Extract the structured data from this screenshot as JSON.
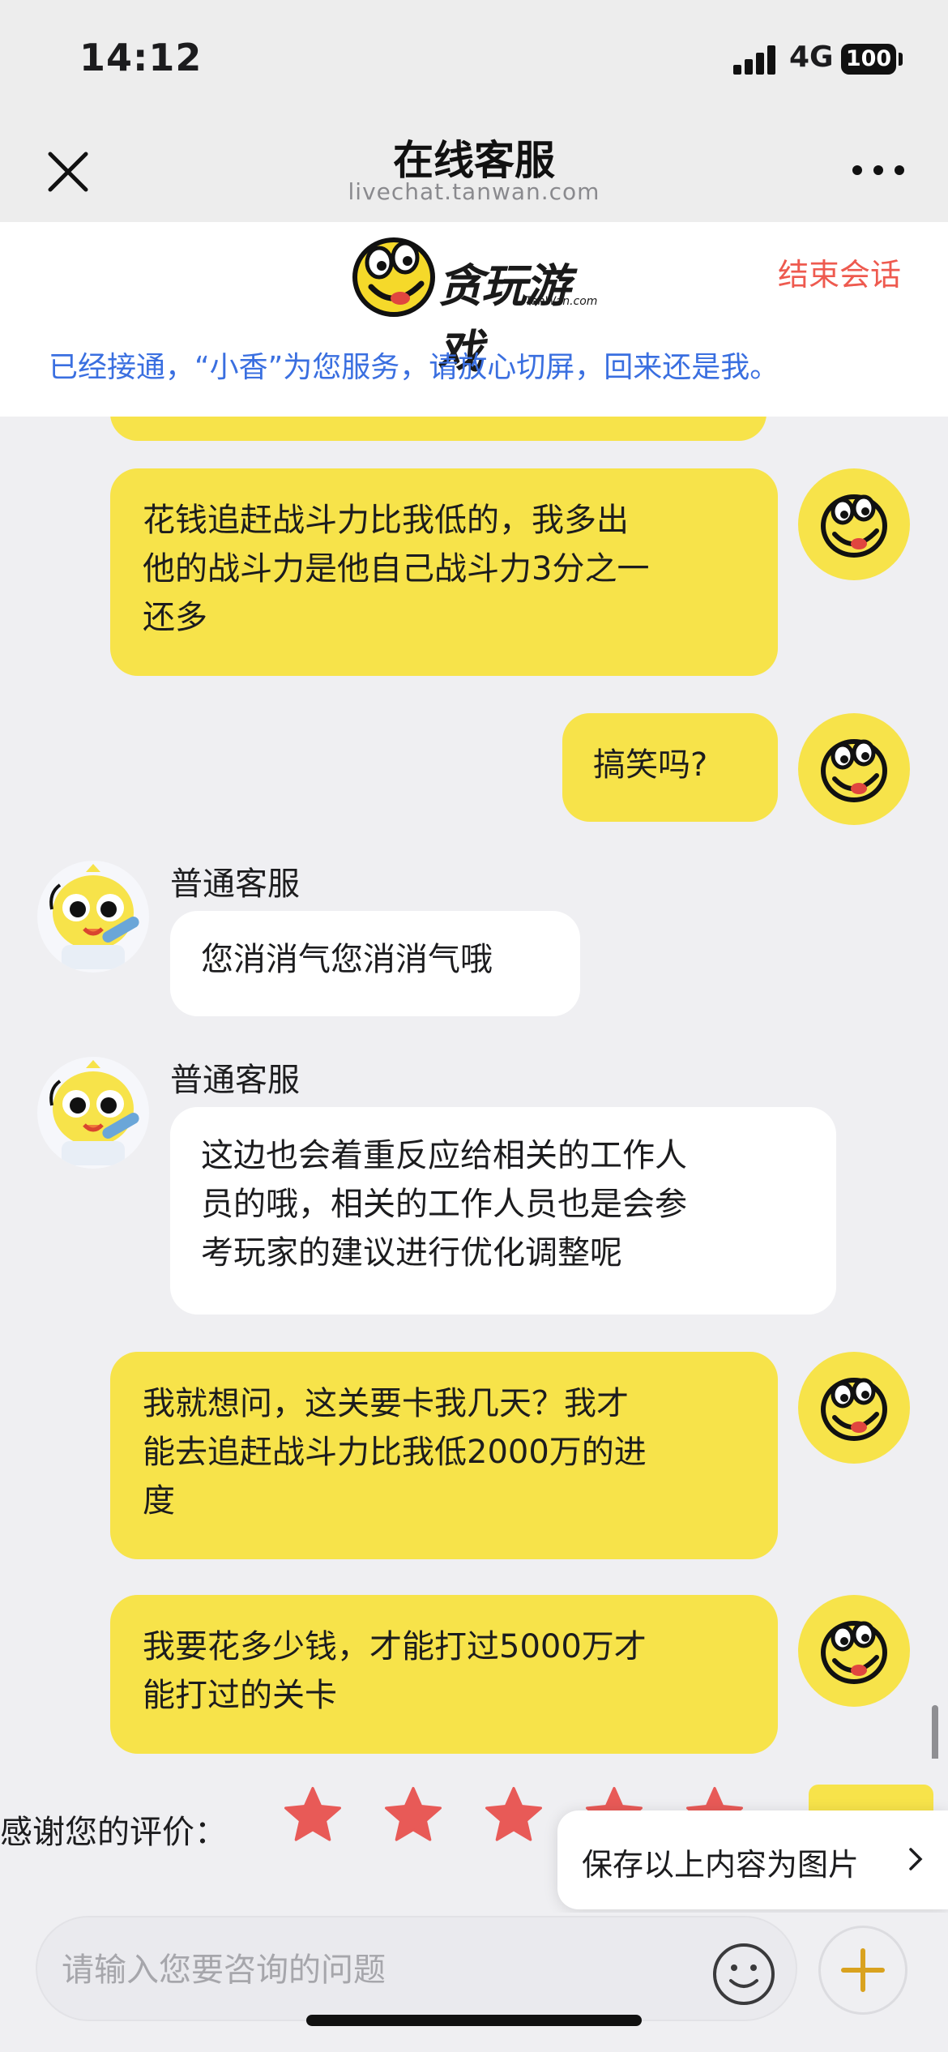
{
  "status_bar": {
    "time": "14:12",
    "network": "4G",
    "battery": "100"
  },
  "nav": {
    "title": "在线客服",
    "subtitle": "livechat.tanwan.com",
    "close_icon": "close-icon",
    "more_icon": "more-icon"
  },
  "header": {
    "logo_text": "贪玩游戏",
    "logo_sub": "TanWan.com",
    "end_chat": "结束会话",
    "notice": "已经接通，“小香”为您服务，请放心切屏，回来还是我。"
  },
  "messages": [
    {
      "from": "user",
      "lines": [
        "花钱追赶战斗力比我低的，我多出",
        "他的战斗力是他自己战斗力3分之一",
        "还多"
      ]
    },
    {
      "from": "user",
      "lines": [
        "搞笑吗?"
      ]
    },
    {
      "from": "agent",
      "name": "普通客服",
      "lines": [
        "您消消气您消消气哦"
      ]
    },
    {
      "from": "agent",
      "name": "普通客服",
      "lines": [
        "这边也会着重反应给相关的工作人",
        "员的哦，相关的工作人员也是会参",
        "考玩家的建议进行优化调整呢"
      ]
    },
    {
      "from": "user",
      "lines": [
        "我就想问，这关要卡我几天？我才",
        "能去追赶战斗力比我低2000万的进",
        "度"
      ]
    },
    {
      "from": "user",
      "lines": [
        "我要花多少钱，才能打过5000万才",
        "能打过的关卡"
      ]
    }
  ],
  "rating": {
    "label": "感谢您的评价：",
    "stars_total": 5,
    "star_color": "#e85a57",
    "save_popup": "保存以上内容为图片"
  },
  "input": {
    "placeholder": "请输入您要咨询的问题",
    "emoji_icon": "smiley-icon",
    "plus_icon": "plus-icon"
  },
  "colors": {
    "accent_yellow": "#f7e34a",
    "notice_blue": "#3a6fe0",
    "end_red": "#ee5a4f"
  }
}
